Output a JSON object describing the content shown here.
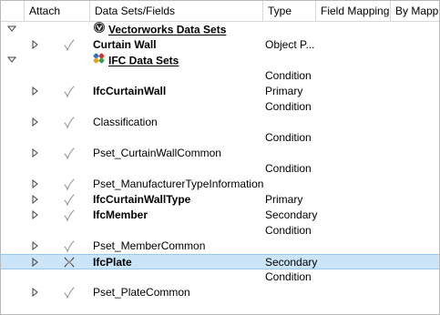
{
  "header": {
    "attach": "Attach",
    "datasets": "Data Sets/Fields",
    "type": "Type",
    "field_mapping": "Field Mapping",
    "by_mapping": "By Mappin"
  },
  "rows": [
    {
      "label": "Vectorworks Data Sets",
      "type": "",
      "expander": "down",
      "level": 0,
      "bold": true,
      "underline": true,
      "icon": "vectorworks-logo-icon",
      "attach": ""
    },
    {
      "label": "Curtain Wall",
      "type": "Object P...",
      "expander": "right",
      "level": 1,
      "bold": true,
      "underline": false,
      "icon": "",
      "attach": "check"
    },
    {
      "label": "IFC Data Sets",
      "type": "",
      "expander": "down",
      "level": 0,
      "bold": true,
      "underline": true,
      "icon": "ifc-logo-icon",
      "attach": ""
    },
    {
      "label": "",
      "type": "Condition",
      "expander": "",
      "level": 1,
      "bold": false,
      "underline": false,
      "icon": "",
      "attach": ""
    },
    {
      "label": "IfcCurtainWall",
      "type": "Primary",
      "expander": "right",
      "level": 1,
      "bold": true,
      "underline": false,
      "icon": "",
      "attach": "check"
    },
    {
      "label": "",
      "type": "Condition",
      "expander": "",
      "level": 1,
      "bold": false,
      "underline": false,
      "icon": "",
      "attach": ""
    },
    {
      "label": "Classification",
      "type": "",
      "expander": "right",
      "level": 1,
      "bold": false,
      "underline": false,
      "icon": "",
      "attach": "check"
    },
    {
      "label": "",
      "type": "Condition",
      "expander": "",
      "level": 1,
      "bold": false,
      "underline": false,
      "icon": "",
      "attach": ""
    },
    {
      "label": "Pset_CurtainWallCommon",
      "type": "",
      "expander": "right",
      "level": 1,
      "bold": false,
      "underline": false,
      "icon": "",
      "attach": "check"
    },
    {
      "label": "",
      "type": "Condition",
      "expander": "",
      "level": 1,
      "bold": false,
      "underline": false,
      "icon": "",
      "attach": ""
    },
    {
      "label": "Pset_ManufacturerTypeInformation",
      "type": "",
      "expander": "right",
      "level": 1,
      "bold": false,
      "underline": false,
      "icon": "",
      "attach": "check"
    },
    {
      "label": "IfcCurtainWallType",
      "type": "Primary",
      "expander": "right",
      "level": 1,
      "bold": true,
      "underline": false,
      "icon": "",
      "attach": "check"
    },
    {
      "label": "IfcMember",
      "type": "Secondary",
      "expander": "right",
      "level": 1,
      "bold": true,
      "underline": false,
      "icon": "",
      "attach": "check"
    },
    {
      "label": "",
      "type": "Condition",
      "expander": "",
      "level": 1,
      "bold": false,
      "underline": false,
      "icon": "",
      "attach": ""
    },
    {
      "label": "Pset_MemberCommon",
      "type": "",
      "expander": "right",
      "level": 1,
      "bold": false,
      "underline": false,
      "icon": "",
      "attach": "check"
    },
    {
      "label": "IfcPlate",
      "type": "Secondary",
      "expander": "right",
      "level": 1,
      "bold": true,
      "underline": false,
      "icon": "",
      "attach": "x",
      "selected": true
    },
    {
      "label": "",
      "type": "Condition",
      "expander": "",
      "level": 1,
      "bold": false,
      "underline": false,
      "icon": "",
      "attach": ""
    },
    {
      "label": "Pset_PlateCommon",
      "type": "",
      "expander": "right",
      "level": 1,
      "bold": false,
      "underline": false,
      "icon": "",
      "attach": "check"
    }
  ],
  "colors": {
    "selection": "#cce4f7",
    "check": "#9a9a9a",
    "grid": "#d8d8d8"
  }
}
